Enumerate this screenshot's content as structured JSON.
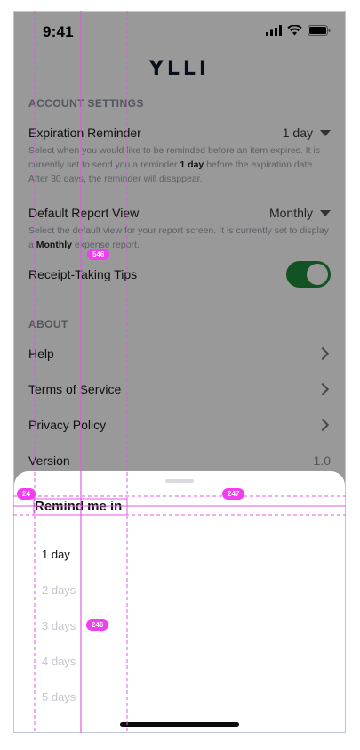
{
  "status_bar": {
    "time": "9:41"
  },
  "app": {
    "logo": "YLLI"
  },
  "account_settings": {
    "header": "ACCOUNT SETTINGS",
    "expiration": {
      "label": "Expiration Reminder",
      "value": "1 day",
      "desc_1": "Select when you would like to be reminded before an item expires. It is currently set to send you a reminder ",
      "desc_bold": "1 day",
      "desc_2": " before the expiration date. After 30 days, the reminder will disappear."
    },
    "report_view": {
      "label": "Default Report View",
      "value": "Monthly",
      "desc_1": "Select the default view for your report screen. It is currently set to display a ",
      "desc_bold": "Monthly",
      "desc_2": " expense report."
    },
    "tips": {
      "label": "Receipt-Taking Tips",
      "enabled": true
    }
  },
  "about": {
    "header": "ABOUT",
    "help": "Help",
    "terms": "Terms of Service",
    "privacy": "Privacy Policy",
    "version_label": "Version",
    "version_value": "1.0"
  },
  "sheet": {
    "title": "Remind me in",
    "options": [
      "1 day",
      "2 days",
      "3 days",
      "4 days",
      "5 days"
    ],
    "selected_index": 0
  },
  "guides": {
    "tag_1": "546",
    "tag_2": "24",
    "tag_3": "247",
    "tag_4": "246"
  }
}
